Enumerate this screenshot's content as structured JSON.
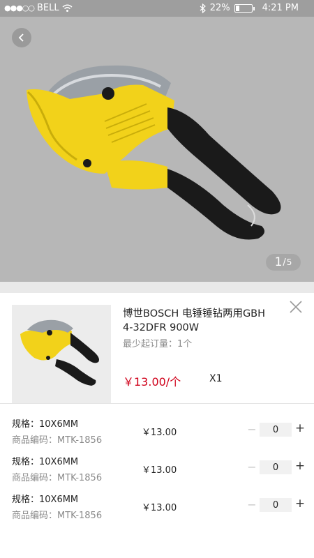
{
  "status_bar": {
    "carrier": "BELL",
    "signal_dots": "●●●○○",
    "battery_percent": "22%",
    "battery_level": 0.22,
    "time": "4:21 PM"
  },
  "gallery": {
    "current_page": "1",
    "separator": "/",
    "total_pages": "5"
  },
  "product": {
    "title": "博世BOSCH 电锤锤钻两用GBH 4-32DFR 900W",
    "min_order": "最少起订量：1个",
    "price": "￥13.00/个",
    "quantity_label": "X1"
  },
  "variants": [
    {
      "spec": "规格：10X6MM",
      "sku": "商品编码：MTK-1856",
      "price": "￥13.00",
      "minus": "−",
      "qty": "0",
      "plus": "+"
    },
    {
      "spec": "规格：10X6MM",
      "sku": "商品编码：MTK-1856",
      "price": "￥13.00",
      "minus": "−",
      "qty": "0",
      "plus": "+"
    },
    {
      "spec": "规格：10X6MM",
      "sku": "商品编码：MTK-1856",
      "price": "￥13.00",
      "minus": "−",
      "qty": "0",
      "plus": "+"
    }
  ],
  "icons": {
    "back": "chevron-left-icon",
    "close": "close-icon",
    "wifi": "wifi-icon",
    "bluetooth": "bluetooth-icon",
    "battery": "battery-icon"
  },
  "colors": {
    "price_red": "#d0021b",
    "gallery_bg": "#b7b7b7",
    "tool_yellow": "#f2d21a",
    "handle_black": "#1a1a1a"
  }
}
